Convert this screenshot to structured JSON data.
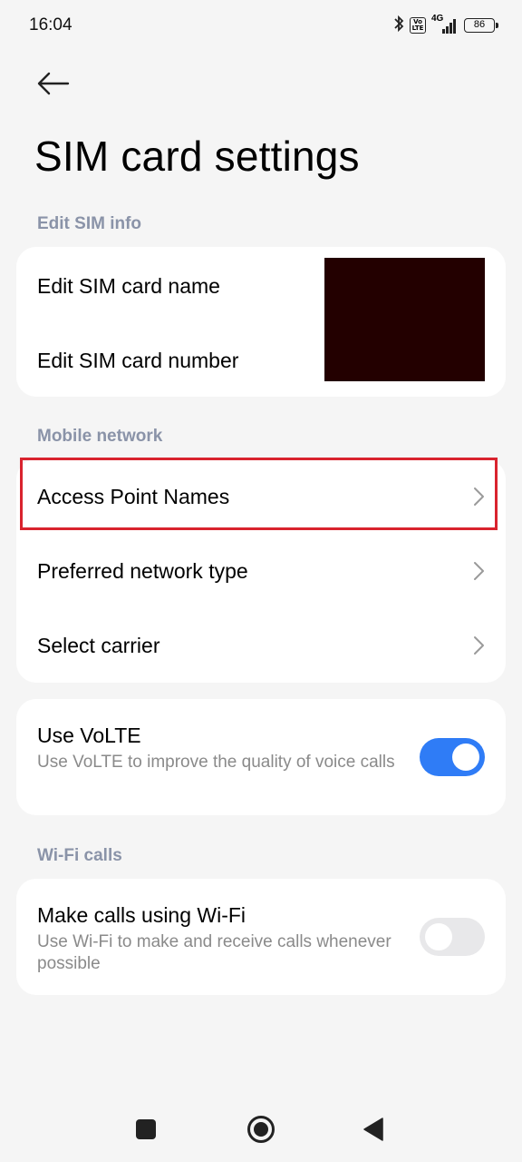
{
  "status_bar": {
    "time": "16:04",
    "volte_top": "Vo",
    "volte_bottom": "LTE",
    "network": "4G",
    "battery": "86",
    "icons": [
      "bluetooth-icon",
      "volte-icon",
      "signal-icon",
      "battery-icon"
    ]
  },
  "header": {
    "back_icon": "arrow-left-icon",
    "title": "SIM card settings"
  },
  "sections": {
    "edit_sim": {
      "label": "Edit SIM info",
      "items": [
        {
          "label": "Edit SIM card name"
        },
        {
          "label": "Edit SIM card number"
        }
      ]
    },
    "mobile_network": {
      "label": "Mobile network",
      "items": [
        {
          "label": "Access Point Names",
          "icon": "chevron-right-icon"
        },
        {
          "label": "Preferred network type",
          "icon": "chevron-right-icon"
        },
        {
          "label": "Select carrier",
          "icon": "chevron-right-icon"
        }
      ]
    },
    "volte": {
      "title": "Use VoLTE",
      "subtitle": "Use VoLTE to improve the quality of voice calls",
      "enabled": true
    },
    "wifi_calls": {
      "label": "Wi-Fi calls",
      "title": "Make calls using Wi-Fi",
      "subtitle": "Use Wi-Fi to make and receive calls whenever possible",
      "enabled": false
    }
  },
  "colors": {
    "accent": "#2f7cf6",
    "highlight": "#d9232e",
    "section_label": "#8a93a8",
    "redacted": "#230000"
  },
  "nav_bar": {
    "icons": [
      "recents-square-icon",
      "home-circle-icon",
      "back-triangle-icon"
    ]
  }
}
